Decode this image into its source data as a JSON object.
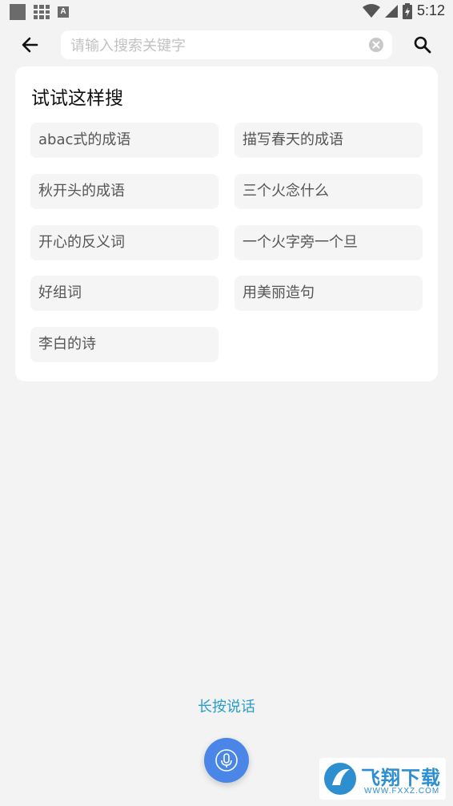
{
  "status_bar": {
    "time": "5:12",
    "app_icon_letter": "A"
  },
  "search": {
    "placeholder": "请输入搜索关键字",
    "value": ""
  },
  "suggestions": {
    "title": "试试这样搜",
    "items": [
      "abac式的成语",
      "描写春天的成语",
      "秋开头的成语",
      "三个火念什么",
      "开心的反义词",
      "一个火字旁一个旦",
      "好组词",
      "用美丽造句",
      "李白的诗"
    ]
  },
  "voice": {
    "hint": "长按说话"
  },
  "watermark": {
    "brand": "飞翔下载",
    "url": "WWW.FXXZ.COM"
  },
  "colors": {
    "background": "#f3f3f3",
    "accent_text": "#2a9dc9",
    "mic_button": "#4a86e8"
  }
}
